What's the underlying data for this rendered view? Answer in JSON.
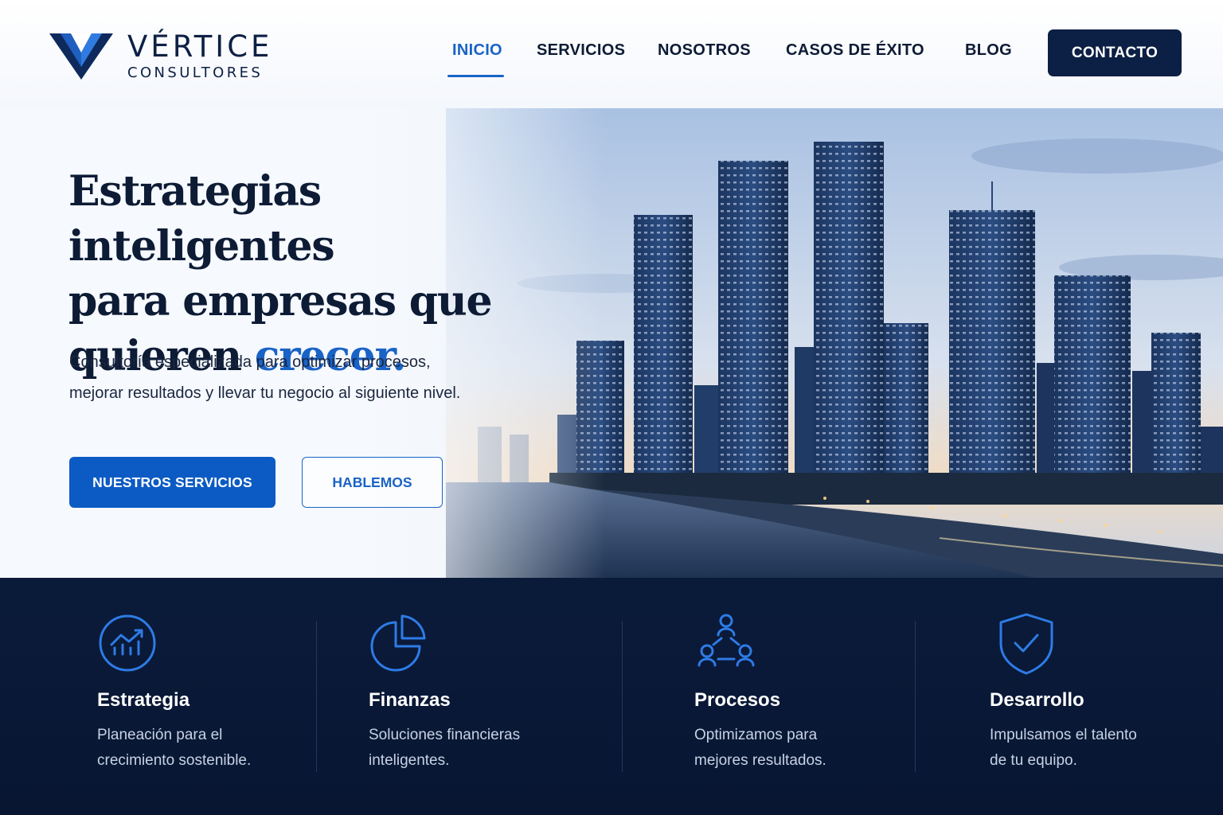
{
  "brand": {
    "name": "VÉRTICE",
    "tagline": "CONSULTORES"
  },
  "nav": {
    "items": [
      {
        "label": "INICIO",
        "active": true
      },
      {
        "label": "SERVICIOS"
      },
      {
        "label": "NOSOTROS"
      },
      {
        "label": "CASOS DE ÉXITO"
      },
      {
        "label": "BLOG"
      }
    ],
    "cta_label": "CONTACTO"
  },
  "hero": {
    "headline_line1": "Estrategias inteligentes",
    "headline_line2": "para empresas que",
    "headline_line3_prefix": "quieren ",
    "headline_accent": "crecer.",
    "subtext_line1": "Consultoría especializada para optimizar procesos,",
    "subtext_line2": "mejorar resultados y llevar tu negocio al siguiente nivel.",
    "primary_button": "NUESTROS SERVICIOS",
    "secondary_button": "HABLEMOS"
  },
  "features": [
    {
      "icon": "growth-chart-icon",
      "title": "Estrategia",
      "desc_line1": "Planeación para el",
      "desc_line2": "crecimiento sostenible."
    },
    {
      "icon": "pie-chart-icon",
      "title": "Finanzas",
      "desc_line1": "Soluciones financieras",
      "desc_line2": "inteligentes."
    },
    {
      "icon": "people-network-icon",
      "title": "Procesos",
      "desc_line1": "Optimizamos para",
      "desc_line2": "mejores resultados."
    },
    {
      "icon": "shield-check-icon",
      "title": "Desarrollo",
      "desc_line1": "Impulsamos el talento",
      "desc_line2": "de tu equipo."
    }
  ],
  "colors": {
    "navy": "#0c1f44",
    "accent_blue": "#1a63c6",
    "features_bg": "#0a1b3a"
  }
}
